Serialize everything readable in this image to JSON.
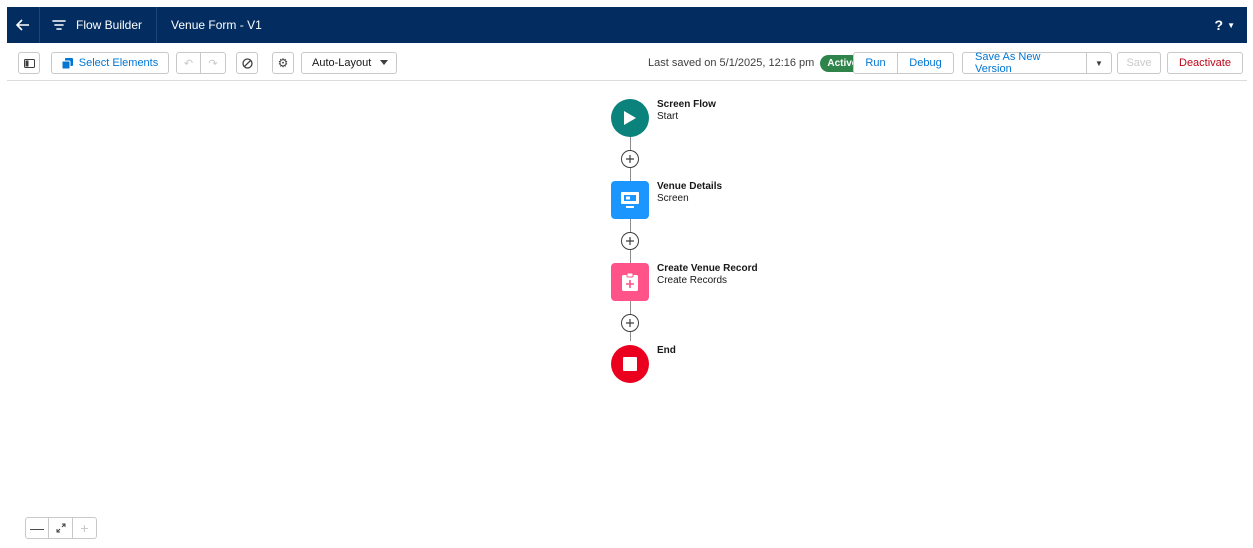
{
  "header": {
    "back_icon": "arrow-left-icon",
    "app_icon": "flow-icon",
    "app_name": "Flow Builder",
    "flow_title": "Venue Form - V1",
    "help_label": "?"
  },
  "toolbar": {
    "select_elements": "Select Elements",
    "layout_mode": "Auto-Layout",
    "saved_text": "Last saved on 5/1/2025, 12:16 pm",
    "status": "Active",
    "run": "Run",
    "debug": "Debug",
    "save_as_new_version": "Save As New Version",
    "save": "Save",
    "deactivate": "Deactivate"
  },
  "flow": {
    "elements": [
      {
        "name": "Screen Flow",
        "type": "Start",
        "icon": "play-icon",
        "color": "#0b827c"
      },
      {
        "name": "Venue Details",
        "type": "Screen",
        "icon": "screen-icon",
        "color": "#1b96ff"
      },
      {
        "name": "Create Venue Record",
        "type": "Create Records",
        "icon": "create-record-icon",
        "color": "#ff538a"
      },
      {
        "name": "End",
        "type": "",
        "icon": "stop-icon",
        "color": "#ea001e"
      }
    ]
  },
  "colors": {
    "header_bg": "#032d60",
    "brand_blue": "#0176d3",
    "active_green": "#2e844a",
    "deactivate_red": "#ba0517"
  }
}
